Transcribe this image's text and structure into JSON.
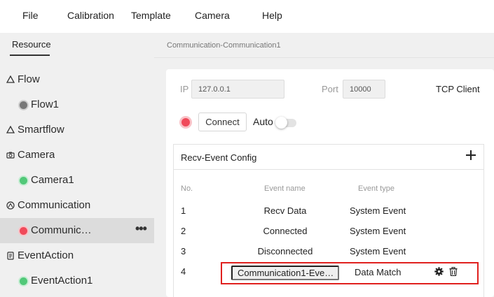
{
  "menu": {
    "items": [
      {
        "label": "File"
      },
      {
        "label": "Calibration"
      },
      {
        "label": "Template"
      },
      {
        "label": "Camera"
      },
      {
        "label": "Help"
      }
    ]
  },
  "sidebar": {
    "tab": "Resource",
    "tree": [
      {
        "label": "Flow",
        "kind": "group",
        "icon": "flow-icon"
      },
      {
        "label": "Flow1",
        "kind": "leaf",
        "status": "gray"
      },
      {
        "label": "Smartflow",
        "kind": "group",
        "icon": "smartflow-icon"
      },
      {
        "label": "Camera",
        "kind": "group",
        "icon": "camera-icon"
      },
      {
        "label": "Camera1",
        "kind": "leaf",
        "status": "green"
      },
      {
        "label": "Communication",
        "kind": "group",
        "icon": "communication-icon"
      },
      {
        "label": "Communic…",
        "kind": "leaf",
        "status": "red",
        "selected": true,
        "more": "•••"
      },
      {
        "label": "EventAction",
        "kind": "group",
        "icon": "event-action-icon"
      },
      {
        "label": "EventAction1",
        "kind": "leaf",
        "status": "green"
      }
    ]
  },
  "main": {
    "breadcrumb": "Communication-Communication1",
    "connection": {
      "ip_label": "IP",
      "ip_value": "127.0.0.1",
      "port_label": "Port",
      "port_value": "10000",
      "mode": "TCP Client",
      "status": "red",
      "connect_label": "Connect",
      "auto_label": "Auto",
      "auto_enabled": false
    },
    "recv_event": {
      "title": "Recv-Event Config",
      "columns": {
        "no": "No.",
        "name": "Event name",
        "type": "Event type"
      },
      "rows": [
        {
          "no": "1",
          "name": "Recv Data",
          "type": "System Event"
        },
        {
          "no": "2",
          "name": "Connected",
          "type": "System Event"
        },
        {
          "no": "3",
          "name": "Disconnected",
          "type": "System Event"
        },
        {
          "no": "4",
          "name": "Communication1-Eve…",
          "type": "Data Match"
        }
      ]
    }
  },
  "colors": {
    "status_red": "#f04a5a",
    "status_green": "#51c878",
    "status_gray": "#777777",
    "highlight": "#e0201e"
  }
}
